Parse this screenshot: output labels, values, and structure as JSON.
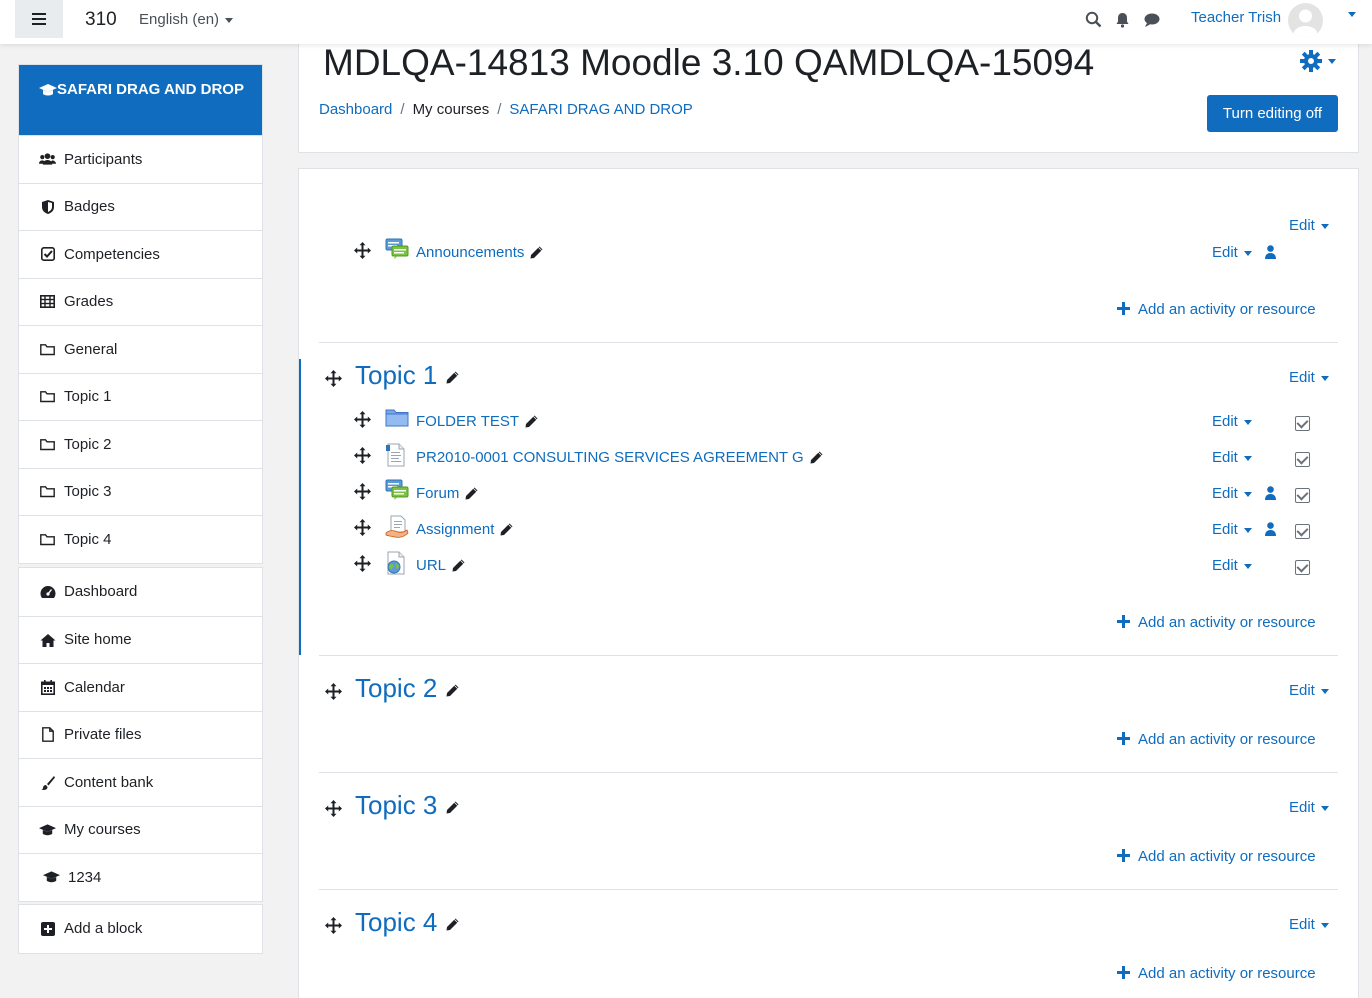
{
  "navbar": {
    "brand": "310",
    "language": "English (en)",
    "user_name": "Teacher Trish"
  },
  "drawer": {
    "course": "SAFARI DRAG AND DROP",
    "course_items": [
      {
        "label": "Participants",
        "icon": "users-icon"
      },
      {
        "label": "Badges",
        "icon": "shield-icon"
      },
      {
        "label": "Competencies",
        "icon": "checkbox-icon"
      },
      {
        "label": "Grades",
        "icon": "table-icon"
      },
      {
        "label": "General",
        "icon": "folder-icon"
      },
      {
        "label": "Topic 1",
        "icon": "folder-icon"
      },
      {
        "label": "Topic 2",
        "icon": "folder-icon"
      },
      {
        "label": "Topic 3",
        "icon": "folder-icon"
      },
      {
        "label": "Topic 4",
        "icon": "folder-icon"
      }
    ],
    "site_items": [
      {
        "label": "Dashboard",
        "icon": "dashboard-icon"
      },
      {
        "label": "Site home",
        "icon": "home-icon"
      },
      {
        "label": "Calendar",
        "icon": "calendar-icon"
      },
      {
        "label": "Private files",
        "icon": "file-icon"
      },
      {
        "label": "Content bank",
        "icon": "brush-icon"
      },
      {
        "label": "My courses",
        "icon": "graduation-cap-icon"
      },
      {
        "label": "1234",
        "icon": "graduation-cap-icon"
      }
    ],
    "add_block": "Add a block"
  },
  "header": {
    "title": "MDLQA-14813 Moodle 3.10 QAMDLQA-15094",
    "breadcrumb": [
      "Dashboard",
      "My courses",
      "SAFARI DRAG AND DROP"
    ],
    "editing_button": "Turn editing off"
  },
  "labels": {
    "edit": "Edit",
    "add_activity": "Add an activity or resource"
  },
  "general": {
    "activities": [
      {
        "name": "Announcements",
        "icon": "forum-icon"
      }
    ]
  },
  "topic1": {
    "title": "Topic 1",
    "activities": [
      {
        "name": "FOLDER TEST",
        "icon": "folder-icon"
      },
      {
        "name": "PR2010-0001 CONSULTING SERVICES AGREEMENT G",
        "icon": "document-icon"
      },
      {
        "name": "Forum",
        "icon": "forum-icon"
      },
      {
        "name": "Assignment",
        "icon": "assignment-icon"
      },
      {
        "name": "URL",
        "icon": "url-icon"
      }
    ]
  },
  "topics": [
    {
      "title": "Topic 2"
    },
    {
      "title": "Topic 3"
    },
    {
      "title": "Topic 4"
    }
  ],
  "colors": {
    "brand": "#0f6cbf",
    "background": "#f2f2f2"
  }
}
